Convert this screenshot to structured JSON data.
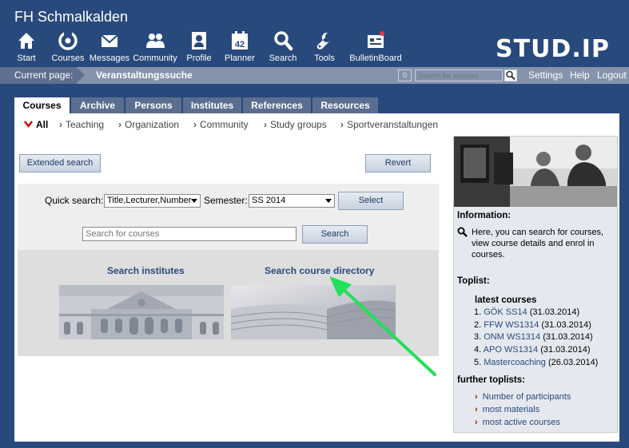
{
  "header": {
    "site_title": "FH Schmalkalden",
    "logo_text": "STUD.IP",
    "nav": [
      {
        "label": "Start",
        "icon": "home-icon"
      },
      {
        "label": "Courses",
        "icon": "courses-icon"
      },
      {
        "label": "Messages",
        "icon": "mail-icon"
      },
      {
        "label": "Community",
        "icon": "community-icon"
      },
      {
        "label": "Profile",
        "icon": "profile-icon"
      },
      {
        "label": "Planner",
        "icon": "calendar-icon",
        "calendar_day": "42"
      },
      {
        "label": "Search",
        "icon": "search-icon"
      },
      {
        "label": "Tools",
        "icon": "wrench-icon"
      },
      {
        "label": "BulletinBoard",
        "icon": "bulletin-icon"
      }
    ]
  },
  "pagebar": {
    "current_label": "Current page:",
    "current_value": "Veranstaltungssuche",
    "counter": "0",
    "search_placeholder": "Search for courses",
    "links": [
      "Settings",
      "Help",
      "Logout"
    ]
  },
  "tabs": [
    {
      "label": "Courses",
      "active": true
    },
    {
      "label": "Archive"
    },
    {
      "label": "Persons"
    },
    {
      "label": "Institutes"
    },
    {
      "label": "References"
    },
    {
      "label": "Resources"
    }
  ],
  "subnav": [
    "All",
    "Teaching",
    "Organization",
    "Community",
    "Study groups",
    "Sportveranstaltungen"
  ],
  "buttons": {
    "extended_search": "Extended search",
    "revert": "Revert",
    "select": "Select",
    "search": "Search"
  },
  "quick_search": {
    "label": "Quick search:",
    "scope_value": "Title,Lecturer,Number",
    "semester_label": "Semester:",
    "semester_value": "SS 2014",
    "placeholder": "Search for courses"
  },
  "directory": {
    "institutes_link": "Search institutes",
    "course_dir_link": "Search course directory"
  },
  "sidebar": {
    "info_heading": "Information:",
    "info_text": "Here, you can search for courses, view course details and enrol in courses.",
    "toplist_heading": "Toplist:",
    "latest_heading": "latest courses",
    "latest": [
      {
        "num": "1.",
        "name": "GÖK SS14",
        "date": "(31.03.2014)"
      },
      {
        "num": "2.",
        "name": "FFW WS1314",
        "date": "(31.03.2014)"
      },
      {
        "num": "3.",
        "name": "ONM WS1314",
        "date": "(31.03.2014)"
      },
      {
        "num": "4.",
        "name": "APO WS1314",
        "date": "(31.03.2014)"
      },
      {
        "num": "5.",
        "name": "Mastercoaching",
        "date": "(26.03.2014)"
      }
    ],
    "further_heading": "further toplists:",
    "further": [
      "Number of participants",
      "most materials",
      "most active courses"
    ]
  },
  "colors": {
    "header_bg": "#28497c",
    "pagebar_bg": "#8594ac",
    "tab_bg": "#5c6e8f",
    "link": "#28497c",
    "active_chevron": "#cc0000",
    "annotation_arrow": "#22e05a"
  }
}
